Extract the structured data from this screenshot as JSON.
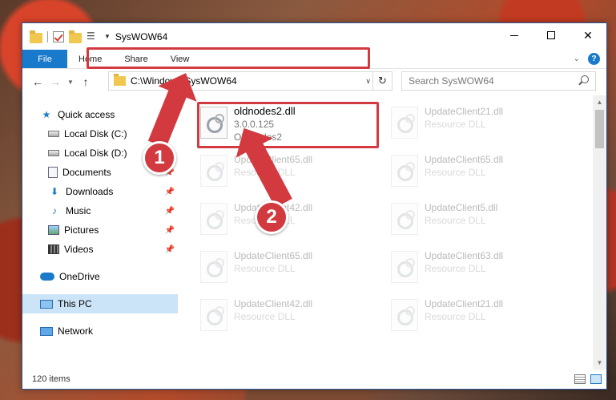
{
  "window": {
    "title": "SysWOW64"
  },
  "ribbon": {
    "tabs": [
      "File",
      "Home",
      "Share",
      "View"
    ]
  },
  "address": {
    "path": "C:\\Windows\\SysWOW64",
    "search_placeholder": "Search SysWOW64"
  },
  "nav": {
    "items": [
      {
        "label": "Quick access",
        "icon": "star-icon"
      },
      {
        "label": "Local Disk (C:)",
        "icon": "disk-icon"
      },
      {
        "label": "Local Disk (D:)",
        "icon": "disk-icon"
      },
      {
        "label": "Documents",
        "icon": "documents-icon"
      },
      {
        "label": "Downloads",
        "icon": "downloads-icon"
      },
      {
        "label": "Music",
        "icon": "music-icon"
      },
      {
        "label": "Pictures",
        "icon": "pictures-icon"
      },
      {
        "label": "Videos",
        "icon": "videos-icon"
      },
      {
        "label": "OneDrive",
        "icon": "onedrive-icon"
      },
      {
        "label": "This PC",
        "icon": "this-pc-icon"
      },
      {
        "label": "Network",
        "icon": "network-icon"
      }
    ]
  },
  "files": [
    {
      "name": "oldnodes2.dll",
      "line2": "3.0.0.125",
      "line3": "OldNodes2"
    },
    {
      "name": "UpdateClient21.dll",
      "line2": "Resource DLL"
    },
    {
      "name": "UpdateClient65.dll",
      "line2": "Resource DLL"
    },
    {
      "name": "UpdateClient65.dll",
      "line2": "Resource DLL"
    },
    {
      "name": "UpdateClient42.dll",
      "line2": "Resource DLL"
    },
    {
      "name": "UpdateClient5.dll",
      "line2": "Resource DLL"
    },
    {
      "name": "UpdateClient65.dll",
      "line2": "Resource DLL"
    },
    {
      "name": "UpdateClient63.dll",
      "line2": "Resource DLL"
    },
    {
      "name": "UpdateClient42.dll",
      "line2": "Resource DLL"
    },
    {
      "name": "UpdateClient21.dll",
      "line2": "Resource DLL"
    }
  ],
  "status": {
    "item_count": "120 items"
  },
  "annotations": {
    "step1": "1",
    "step2": "2",
    "color": "#d33a3f"
  }
}
